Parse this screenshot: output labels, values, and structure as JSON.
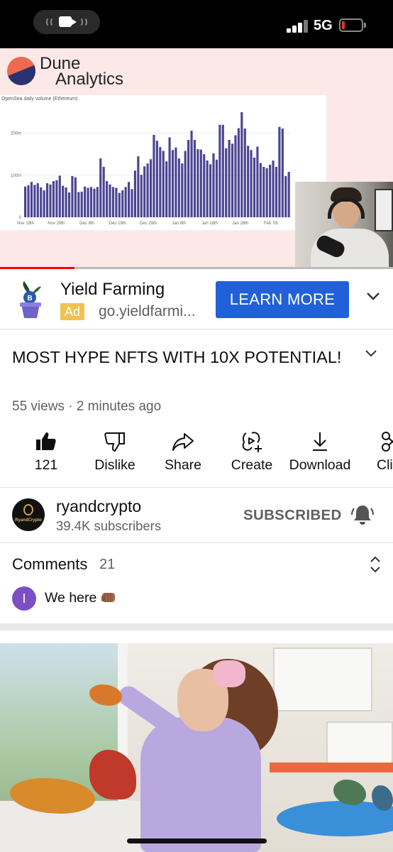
{
  "status_bar": {
    "network": "5G",
    "battery_color": "#e03030"
  },
  "video": {
    "logo_line1": "Dune",
    "logo_line2": "Analytics",
    "progress_fraction": 0.19,
    "chart_data": {
      "type": "bar",
      "title": "OpenSea daily volume (Ethereum)",
      "x_ticks": [
        "Nov 19th",
        "Nov 29th",
        "Dec 9th",
        "Dec 19th",
        "Dec 29th",
        "Jan 8th",
        "Jan 18th",
        "Jan 28th",
        "Feb 7th"
      ],
      "y_ticks": [
        "0",
        "100m",
        "200m"
      ],
      "ylim": [
        0,
        250
      ],
      "values": [
        73,
        76,
        84,
        77,
        81,
        71,
        64,
        81,
        78,
        86,
        88,
        99,
        75,
        71,
        59,
        98,
        95,
        60,
        61,
        73,
        70,
        72,
        68,
        72,
        140,
        120,
        86,
        78,
        72,
        70,
        58,
        64,
        72,
        84,
        67,
        111,
        145,
        101,
        121,
        128,
        138,
        196,
        182,
        167,
        158,
        133,
        190,
        160,
        166,
        140,
        128,
        158,
        184,
        206,
        184,
        162,
        161,
        150,
        135,
        126,
        152,
        137,
        220,
        220,
        164,
        184,
        175,
        195,
        212,
        250,
        211,
        170,
        160,
        142,
        168,
        129,
        120,
        117,
        125,
        135,
        120,
        215,
        211,
        98,
        108
      ]
    }
  },
  "ad": {
    "title": "Yield Farming",
    "badge": "Ad",
    "url": "go.yieldfarmi...",
    "button": "LEARN MORE"
  },
  "video_info": {
    "title": "MOST HYPE NFTS WITH 10X POTENTIAL!",
    "meta": "55 views · 2 minutes ago"
  },
  "actions": [
    {
      "label": "121",
      "icon": "thumbs-up-icon"
    },
    {
      "label": "Dislike",
      "icon": "thumbs-down-icon"
    },
    {
      "label": "Share",
      "icon": "share-icon"
    },
    {
      "label": "Create",
      "icon": "create-icon"
    },
    {
      "label": "Download",
      "icon": "download-icon"
    },
    {
      "label": "Cli",
      "icon": "clip-icon"
    }
  ],
  "channel": {
    "name": "ryandcrypto",
    "subscribers": "39.4K subscribers",
    "avatar_text": "RyandCrypto",
    "subscribe_label": "SUBSCRIBED"
  },
  "comments": {
    "label": "Comments",
    "count": "21",
    "first_initial": "I",
    "first_text": "We here",
    "first_avatar_color": "#7c4fc4"
  },
  "colors": {
    "accent_blue": "#2160d8",
    "ad_badge": "#f2c14e",
    "progress_red": "#ff0000",
    "chart_bar": "#4b4593"
  }
}
